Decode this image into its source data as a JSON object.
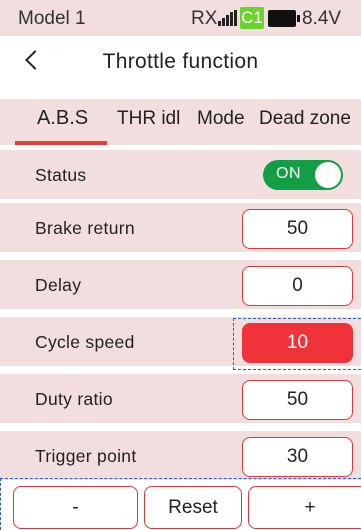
{
  "status_bar": {
    "model": "Model 1",
    "rx": "RX",
    "signal_icon": "signal-bars-icon",
    "channel": "C1",
    "channel_color": "#6bd42c",
    "battery_icon": "battery-full-icon",
    "voltage": "8.4V"
  },
  "header": {
    "back_icon": "chevron-left-icon",
    "title": "Throttle function"
  },
  "tabs": [
    {
      "label": "A.B.S",
      "active": true
    },
    {
      "label": "THR idl",
      "active": false
    },
    {
      "label": "Mode",
      "active": false
    },
    {
      "label": "Dead zone",
      "active": false
    }
  ],
  "rows": [
    {
      "label": "Status",
      "type": "toggle",
      "value": "ON"
    },
    {
      "label": "Brake return",
      "type": "value",
      "value": "50"
    },
    {
      "label": "Delay",
      "type": "value",
      "value": "0"
    },
    {
      "label": "Cycle speed",
      "type": "value",
      "value": "10",
      "selected": true
    },
    {
      "label": "Duty ratio",
      "type": "value",
      "value": "50"
    },
    {
      "label": "Trigger point",
      "type": "value",
      "value": "30"
    }
  ],
  "buttons": {
    "minus": "-",
    "reset": "Reset",
    "plus": "+"
  },
  "colors": {
    "accent": "#e0373b",
    "selected_fill": "#f0323a",
    "toggle_on": "#119e45",
    "row_bg": "#f2dede",
    "focus_outline": "#2d59d6"
  }
}
